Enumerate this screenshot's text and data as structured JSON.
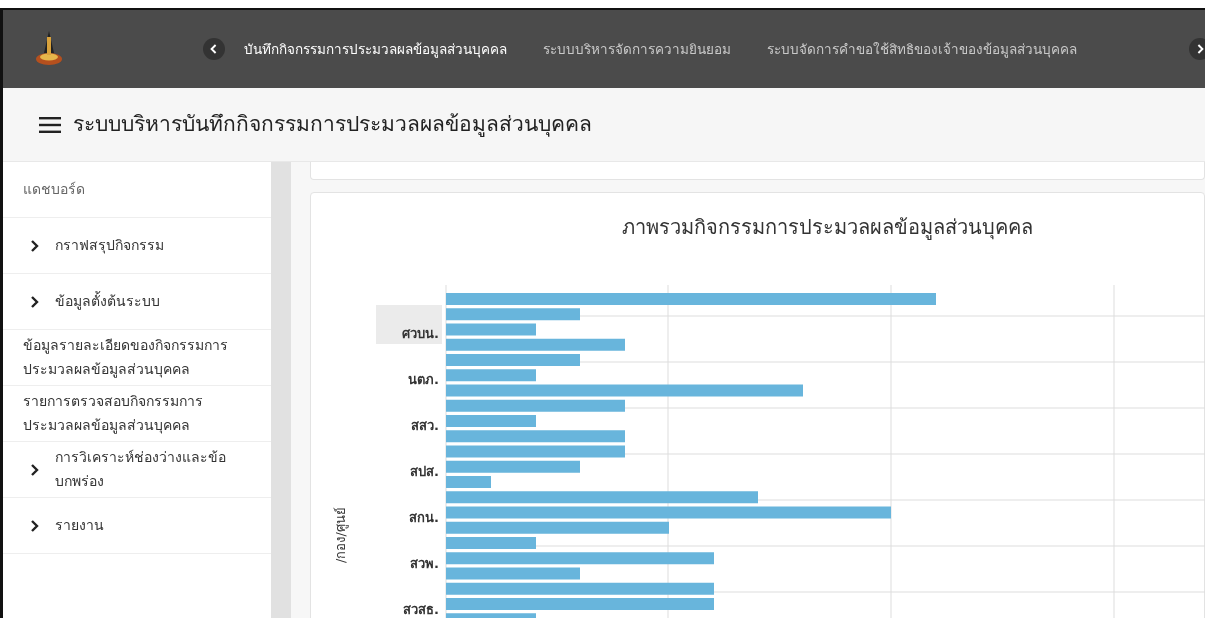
{
  "navbar": {
    "tabs": [
      {
        "label": "บันทึกกิจกรรมการประมวลผลข้อมูลส่วนบุคคล",
        "selected": true
      },
      {
        "label": "ระบบบริหารจัดการความยินยอม",
        "selected": false
      },
      {
        "label": "ระบบจัดการคำขอใช้สิทธิของเจ้าของข้อมูลส่วนบุคคล",
        "selected": false
      }
    ]
  },
  "page_title": "ระบบบริหารบันทึกกิจกรรมการประมวลผลข้อมูลส่วนบุคคล",
  "sidebar": {
    "items": [
      {
        "label": "แดชบอร์ด",
        "kind": "link"
      },
      {
        "label": "กราฟสรุปกิจกรรม",
        "kind": "group"
      },
      {
        "label": "ข้อมูลตั้งต้นระบบ",
        "kind": "group"
      },
      {
        "label": "ข้อมูลรายละเอียดของกิจกรรมการประมวลผลข้อมูลส่วนบุคคล",
        "kind": "link"
      },
      {
        "label": "รายการตรวจสอบกิจกรรมการประมวลผลข้อมูลส่วนบุคคล",
        "kind": "link"
      },
      {
        "label": "การวิเคราะห์ช่องว่างและข้อบกพร่อง",
        "kind": "group"
      },
      {
        "label": "รายงาน",
        "kind": "group"
      }
    ]
  },
  "chart": {
    "title": "ภาพรวมกิจกรรมการประมวลผลข้อมูลส่วนบุคคล",
    "ylabel": "/กอง/ศูนย์",
    "categories": [
      {
        "label": "ศวบน.",
        "highlighted": true
      },
      {
        "label": "นตภ.",
        "highlighted": false
      },
      {
        "label": "สสว.",
        "highlighted": false
      },
      {
        "label": "สปส.",
        "highlighted": false
      },
      {
        "label": "สกน.",
        "highlighted": false
      },
      {
        "label": "สวพ.",
        "highlighted": false
      },
      {
        "label": "สวสธ.",
        "highlighted": false
      }
    ]
  }
}
